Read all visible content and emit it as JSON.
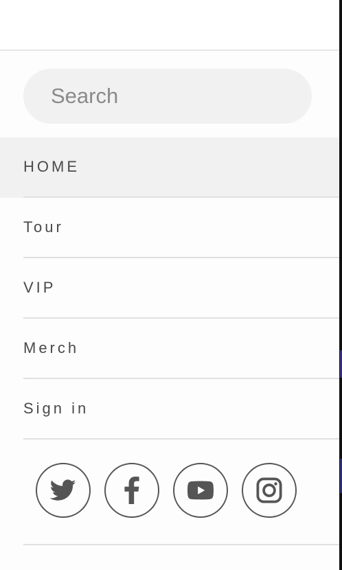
{
  "search": {
    "placeholder": "Search"
  },
  "nav": {
    "items": [
      {
        "label": "HOME",
        "active": true
      },
      {
        "label": "Tour",
        "active": false
      },
      {
        "label": "VIP",
        "active": false
      },
      {
        "label": "Merch",
        "active": false
      },
      {
        "label": "Sign in",
        "active": false
      }
    ]
  },
  "socials": [
    {
      "icon": "twitter-icon"
    },
    {
      "icon": "facebook-icon"
    },
    {
      "icon": "youtube-icon"
    },
    {
      "icon": "instagram-icon"
    }
  ],
  "colors": {
    "active_bg": "#f1f1f1",
    "text": "#4a4a4a",
    "icon": "#555555",
    "divider": "#e0e0e0"
  }
}
